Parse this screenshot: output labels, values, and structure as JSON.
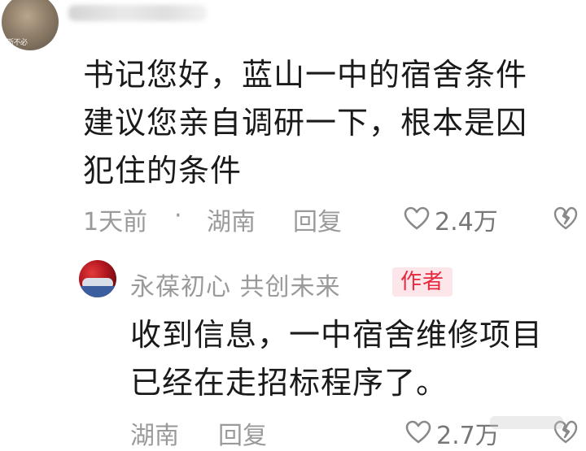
{
  "top_comment": {
    "avatar_caption": "斯不必",
    "text_lines": [
      "书记您好，蓝山一中的宿舍条件",
      "建议您亲自调研一下，根本是囚",
      "犯住的条件"
    ],
    "time": "1天前",
    "separator": "·",
    "location": "湖南",
    "reply_label": "回复",
    "like_count": "2.4万"
  },
  "reply": {
    "author_name": "永葆初心  共创未来",
    "author_badge": "作者",
    "text_lines": [
      "收到信息，一中宿舍维修项目",
      "已经在走招标程序了。"
    ],
    "location": "湖南",
    "reply_label": "回复",
    "like_count": "2.7万"
  },
  "colors": {
    "text_primary": "#1a1a1a",
    "text_secondary": "#9a9a9a",
    "badge_text": "#e8283f",
    "badge_background": "#fde6ea"
  },
  "icons": {
    "like": "heart-outline-icon",
    "dislike": "broken-heart-icon"
  }
}
